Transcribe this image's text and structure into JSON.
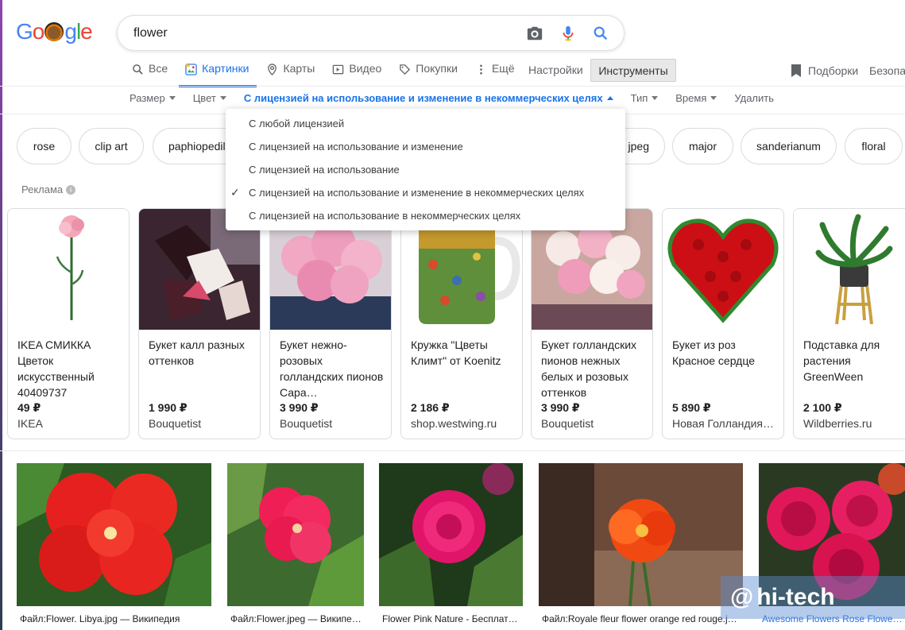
{
  "logo": "Google",
  "search": {
    "query": "flower"
  },
  "tabs": [
    {
      "label": "Все",
      "icon": "search-icon"
    },
    {
      "label": "Картинки",
      "icon": "images-icon"
    },
    {
      "label": "Карты",
      "icon": "map-pin-icon"
    },
    {
      "label": "Видео",
      "icon": "video-icon"
    },
    {
      "label": "Покупки",
      "icon": "tag-icon"
    },
    {
      "label": "Ещё",
      "icon": "more-vert-icon"
    }
  ],
  "settings_label": "Настройки",
  "tools_label": "Инструменты",
  "collections_label": "Подборки",
  "safe_label": "Безопасн",
  "filters": {
    "size": "Размер",
    "color": "Цвет",
    "license": "С лицензией на использование и изменение в некоммерческих целях",
    "type": "Тип",
    "time": "Время",
    "clear": "Удалить"
  },
  "chips": [
    "rose",
    "clip art",
    "paphiopedil",
    "jpeg",
    "major",
    "sanderianum",
    "floral"
  ],
  "license_menu": [
    {
      "label": "С любой лицензией",
      "checked": false
    },
    {
      "label": "С лицензией на использование и изменение",
      "checked": false
    },
    {
      "label": "С лицензией на использование",
      "checked": false
    },
    {
      "label": "С лицензией на использование и изменение в некоммерческих целях",
      "checked": true
    },
    {
      "label": "С лицензией на использование в некоммерческих целях",
      "checked": false
    }
  ],
  "ads_label": "Реклама",
  "products": [
    {
      "title": "IKEA СМИККА Цветок искусственный 40409737",
      "price": "49 ₽",
      "store": "IKEA"
    },
    {
      "title": "Букет калл разных оттенков",
      "price": "1 990 ₽",
      "store": "Bouquetist"
    },
    {
      "title": "Букет нежно-розовых голландских пионов Сара…",
      "price": "3 990 ₽",
      "store": "Bouquetist"
    },
    {
      "title": "Кружка \"Цветы Климт\" от Koenitz",
      "price": "2 186 ₽",
      "store": "shop.westwing.ru"
    },
    {
      "title": "Букет голландских пионов нежных белых и розовых оттенков",
      "price": "3 990 ₽",
      "store": "Bouquetist"
    },
    {
      "title": "Букет из роз Красное сердце",
      "price": "5 890 ₽",
      "store": "Новая Голландия…"
    },
    {
      "title": "Подставка для растения GreenWeen",
      "price": "2 100 ₽",
      "store": "Wildberries.ru"
    }
  ],
  "results": [
    {
      "caption": "Файл:Flower. Libya.jpg — Википедия"
    },
    {
      "caption": "Файл:Flower.jpeg — Википе…"
    },
    {
      "caption": "Flower Pink Nature - Бесплат…"
    },
    {
      "caption": "Файл:Royale fleur flower orange red rouge.j…"
    },
    {
      "caption": "Awesome Flowers Rose Flower F…"
    }
  ],
  "watermark": "hi-tech"
}
